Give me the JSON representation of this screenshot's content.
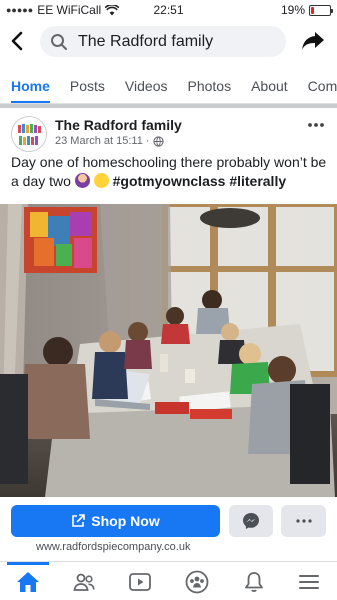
{
  "status": {
    "carrier": "EE WiFiCall",
    "time": "22:51",
    "battery": "19%",
    "battery_level": 0.19
  },
  "search": {
    "query": "The Radford family"
  },
  "tabs": [
    {
      "label": "Home"
    },
    {
      "label": "Posts"
    },
    {
      "label": "Videos"
    },
    {
      "label": "Photos"
    },
    {
      "label": "About"
    },
    {
      "label": "Com"
    }
  ],
  "post": {
    "author": "The Radford family",
    "timestamp": "23 March at 15:11 ·",
    "text": "Day one of homeschooling there probably won’t be a day two",
    "hashtags": "#gotmyownclass #literally"
  },
  "actions": {
    "shop_label": "Shop Now",
    "website": "www.radfordspiecompany.co.uk"
  },
  "icons": {
    "back": "chevron-left-icon",
    "search": "search-icon",
    "share": "share-arrow-icon",
    "globe": "globe-icon",
    "messenger": "messenger-icon",
    "home": "home-icon",
    "friends": "friends-icon",
    "watch": "watch-icon",
    "groups": "groups-icon",
    "notifications": "bell-icon",
    "menu": "menu-icon"
  },
  "colors": {
    "accent": "#1877f2",
    "battery_low": "#e02424"
  }
}
